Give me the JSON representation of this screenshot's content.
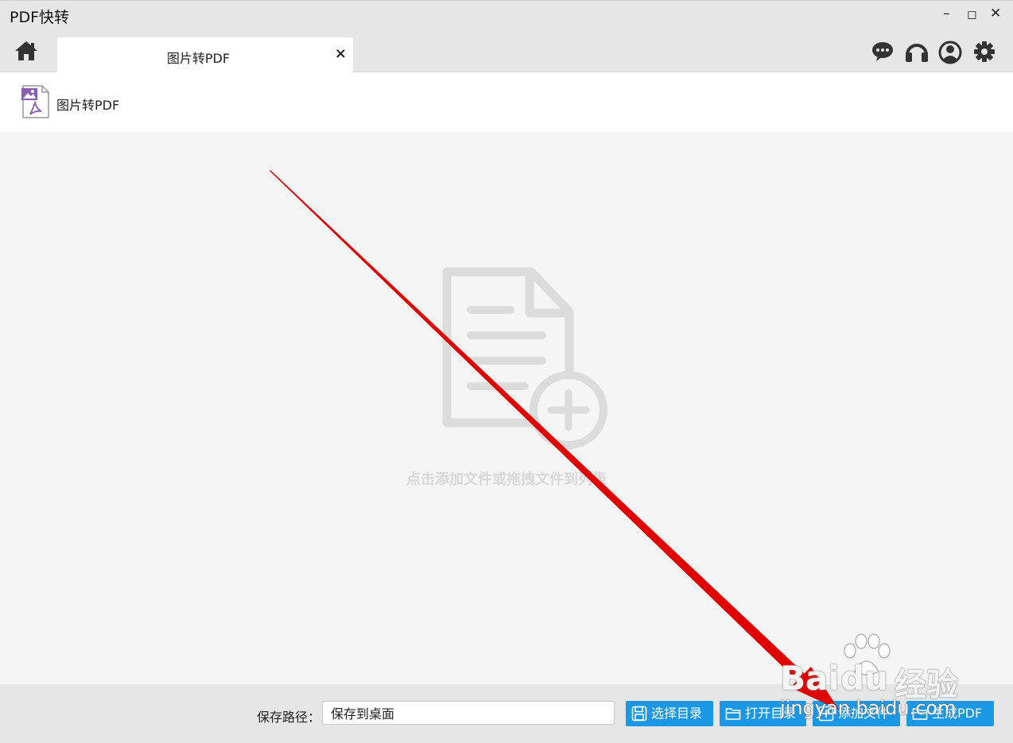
{
  "app": {
    "title": "PDF快转"
  },
  "window_controls": {
    "minimize": "–",
    "maximize": "◻",
    "close": "✕"
  },
  "tabs": [
    {
      "label": "图片转PDF",
      "close": "×"
    }
  ],
  "header_icons": [
    "chat-icon",
    "headphones-icon",
    "user-icon",
    "gear-icon"
  ],
  "toolbar": {
    "tool_label": "图片转PDF"
  },
  "drop_area": {
    "hint": "点击添加文件或拖拽文件到列表"
  },
  "bottom": {
    "save_label": "保存路径：",
    "save_value": "保存到桌面",
    "buttons": [
      {
        "label": "选择目录",
        "icon": "save-icon"
      },
      {
        "label": "打开目录",
        "icon": "folder-icon"
      },
      {
        "label": "添加文件",
        "icon": "add-file-icon"
      },
      {
        "label": "生成PDF",
        "icon": "folder-icon"
      }
    ]
  },
  "watermark": {
    "brand_left": "Bai",
    "brand_mid": "du",
    "brand_right": "经验",
    "url": "jingyan.baidu.com"
  },
  "colors": {
    "accent": "#1a98e6",
    "arrow": "#e00000",
    "chrome": "#e6e6e6"
  }
}
